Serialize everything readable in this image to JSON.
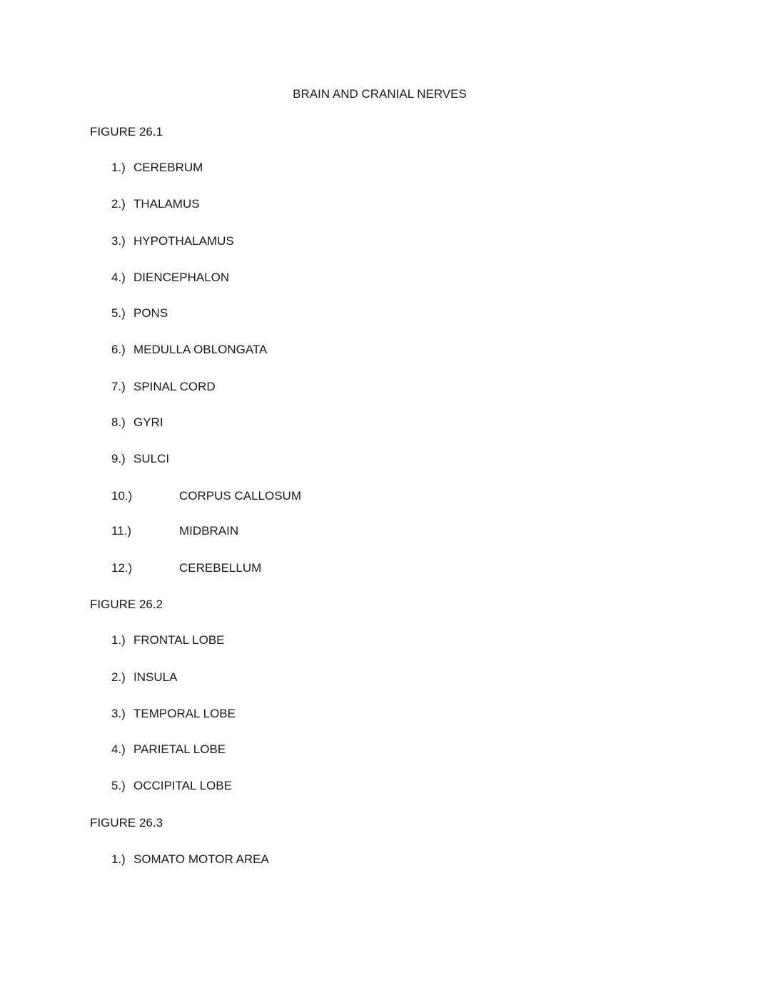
{
  "document": {
    "title": "BRAIN AND CRANIAL NERVES",
    "sections": [
      {
        "heading": "FIGURE 26.1",
        "items": [
          {
            "num": "1.)",
            "label": "CEREBRUM"
          },
          {
            "num": "2.)",
            "label": "THALAMUS"
          },
          {
            "num": "3.)",
            "label": "HYPOTHALAMUS"
          },
          {
            "num": "4.)",
            "label": "DIENCEPHALON"
          },
          {
            "num": "5.)",
            "label": "PONS"
          },
          {
            "num": "6.)",
            "label": "MEDULLA OBLONGATA"
          },
          {
            "num": "7.)",
            "label": "SPINAL CORD"
          },
          {
            "num": "8.)",
            "label": "GYRI"
          },
          {
            "num": "9.)",
            "label": "SULCI"
          },
          {
            "num": "10.)",
            "label": "CORPUS CALLOSUM"
          },
          {
            "num": "11.)",
            "label": "MIDBRAIN"
          },
          {
            "num": "12.)",
            "label": "CEREBELLUM"
          }
        ]
      },
      {
        "heading": "FIGURE 26.2",
        "items": [
          {
            "num": "1.)",
            "label": "FRONTAL LOBE"
          },
          {
            "num": "2.)",
            "label": "INSULA"
          },
          {
            "num": "3.)",
            "label": "TEMPORAL LOBE"
          },
          {
            "num": "4.)",
            "label": "PARIETAL LOBE"
          },
          {
            "num": "5.)",
            "label": "OCCIPITAL LOBE"
          }
        ]
      },
      {
        "heading": "FIGURE 26.3",
        "items": [
          {
            "num": "1.)",
            "label": "SOMATO MOTOR AREA"
          }
        ]
      }
    ]
  }
}
